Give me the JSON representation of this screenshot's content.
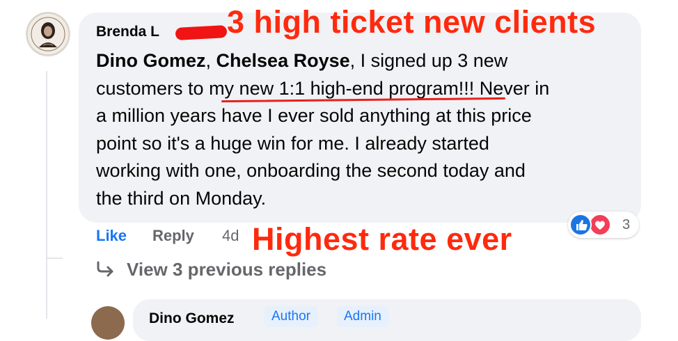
{
  "comment": {
    "author": "Brenda L",
    "mentions": [
      "Dino Gomez",
      "Chelsea Royse"
    ],
    "separator": ", ",
    "lines": [
      ", I signed up 3 new",
      "customers to ",
      "my new 1:1 high-end program!!!",
      " Never in",
      "a million years have I ever sold anything at this price",
      "point so it's a huge win for me. I already started",
      "working with one, onboarding the second today and",
      "the third on Monday."
    ]
  },
  "actions": {
    "like_label": "Like",
    "reply_label": "Reply",
    "timestamp": "4d"
  },
  "reactions": {
    "types": [
      "like-icon",
      "love-icon"
    ],
    "count": "3"
  },
  "view_replies": {
    "icon": "reply-arrow-icon",
    "label": "View 3 previous replies"
  },
  "annotations": {
    "top": "3 high ticket new clients",
    "middle": "Highest rate ever",
    "color": "#fe2a0e"
  },
  "next_comment": {
    "author": "Dino Gomez",
    "badges": [
      "Author",
      "Admin"
    ]
  },
  "colors": {
    "bubble": "#f0f2f5",
    "link_blue": "#1877f2",
    "muted": "#65676b",
    "like_blue": "#1b74e4",
    "love_red": "#f33e58"
  }
}
